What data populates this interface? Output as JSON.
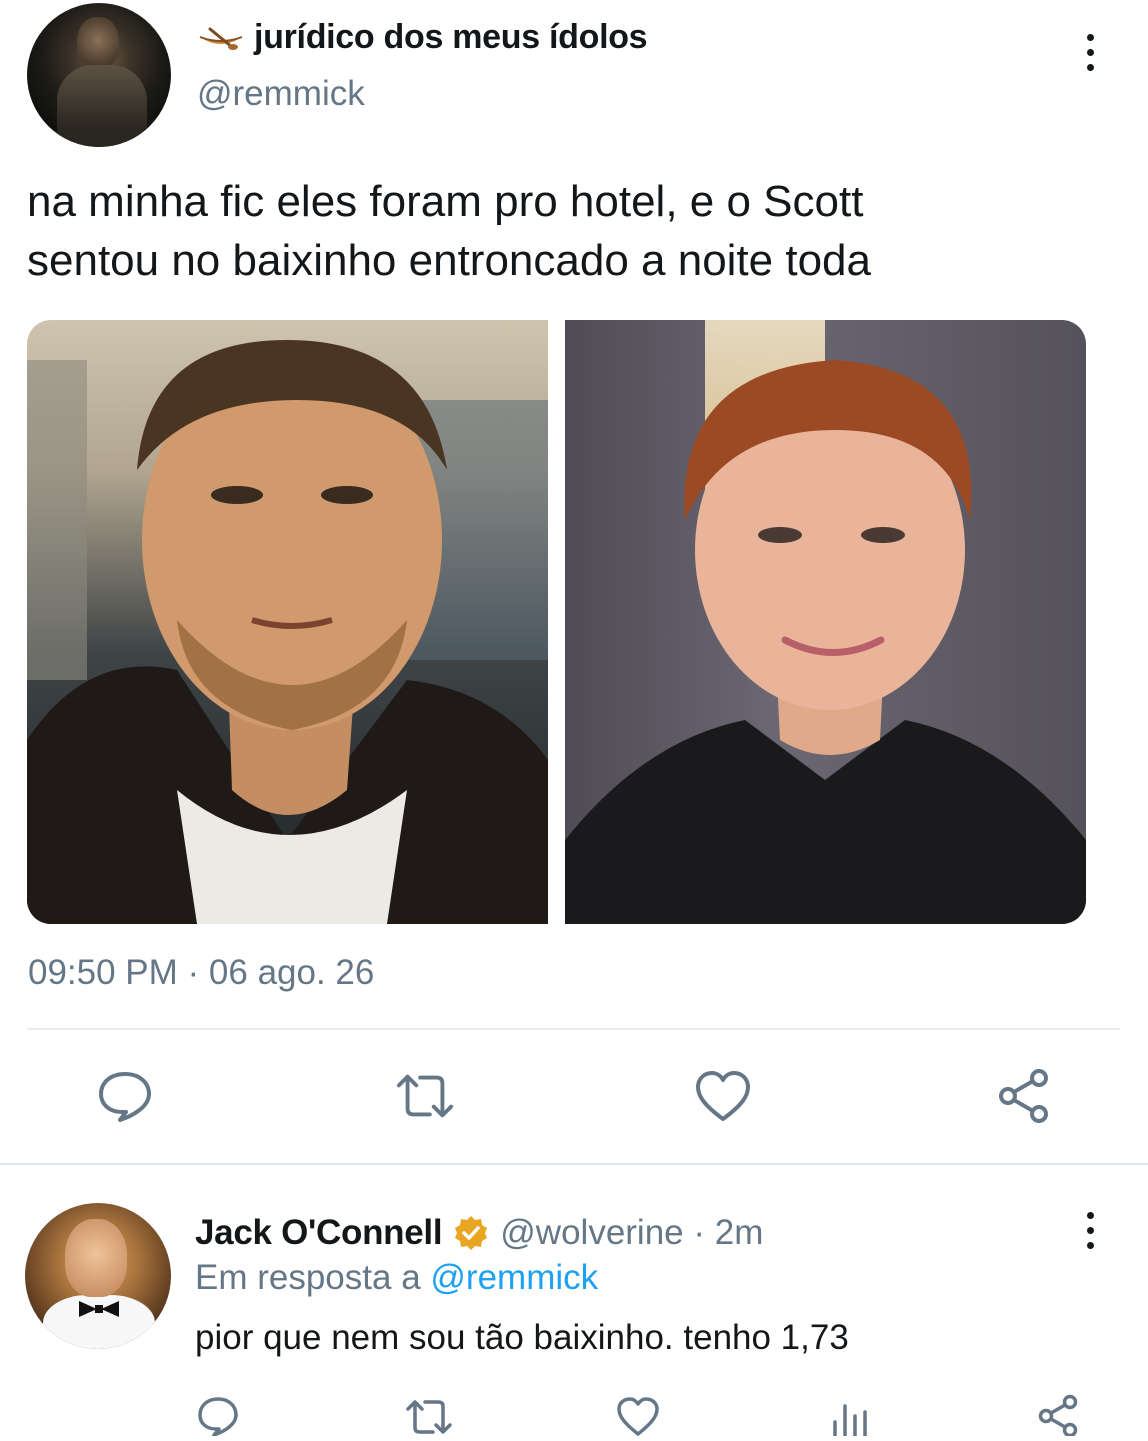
{
  "main_tweet": {
    "display_name": "jurídico dos meus ídolos",
    "handle": "@remmick",
    "text": "na minha fic eles foram pro hotel, e o Scott\nsentou no baixinho entroncado a noite toda",
    "timestamp": "09:50 PM · 06 ago. 26",
    "name_emoji_icon": "canoe-icon",
    "actions": [
      "reply-icon",
      "retweet-icon",
      "like-icon",
      "share-icon"
    ]
  },
  "reply": {
    "display_name": "Jack O'Connell",
    "verified_icon": "verified-badge-icon",
    "handle_time": "@wolverine · 2m",
    "in_reply_prefix": "Em resposta a ",
    "in_reply_mention": "@remmick",
    "text": "pior que nem sou tão baixinho. tenho 1,73",
    "actions": [
      "reply-icon",
      "retweet-icon",
      "like-icon",
      "views-icon",
      "share-icon"
    ]
  },
  "colors": {
    "text": "#14171a",
    "secondary": "#657786",
    "link": "#1da1f2",
    "verified": "#e8a623",
    "divider": "#e6ecf0"
  }
}
